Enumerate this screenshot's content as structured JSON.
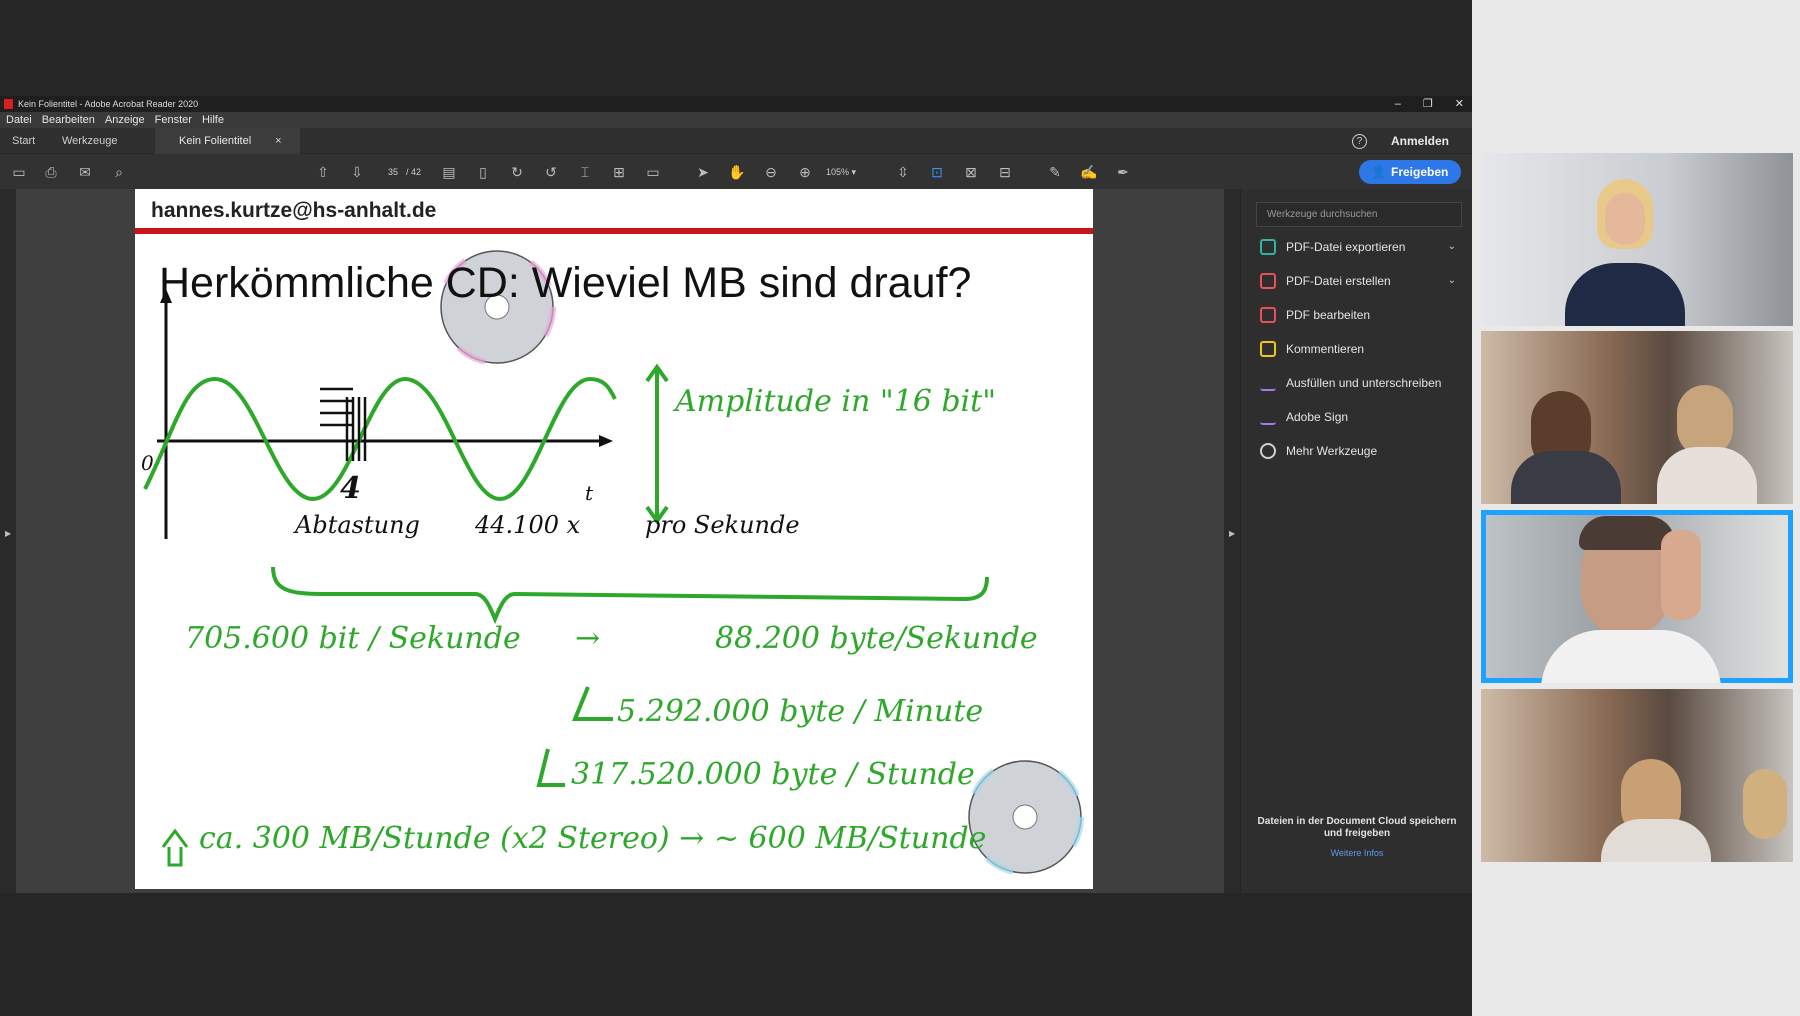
{
  "window": {
    "title": "Kein Folientitel - Adobe Acrobat Reader 2020",
    "controls": [
      "–",
      "❐",
      "✕"
    ]
  },
  "menu": [
    "Datei",
    "Bearbeiten",
    "Anzeige",
    "Fenster",
    "Hilfe"
  ],
  "tabs": {
    "start": "Start",
    "tools": "Werkzeuge",
    "document": "Kein Folientitel",
    "close": "×",
    "help": "?",
    "signin": "Anmelden"
  },
  "toolbar": {
    "page_current": "35",
    "page_total": "/ 42",
    "zoom": "105%",
    "zoom_arrow": "▾",
    "share": "Freigeben"
  },
  "slide": {
    "email": "hannes.kurtze@hs-anhalt.de",
    "heading": "Herkömmliche CD: Wieviel MB sind drauf?",
    "axis_zero": "0",
    "axis_t": "t",
    "arrow_label": "4",
    "amplitude": "Amplitude in \"16 bit\"",
    "sampling": "Abtastung",
    "rate": "44.100 x",
    "per_second": "pro Sekunde",
    "line1_left": "705.600 bit / Sekunde",
    "line1_right": "88.200 byte/Sekunde",
    "line2": "5.292.000 byte / Minute",
    "line3": "317.520.000 byte / Stunde",
    "line4": "ca. 300 MB/Stunde (x2 Stereo) → ~ 600 MB/Stunde",
    "colors": {
      "ink_green": "#2ea82b",
      "red_rule": "#c8151b"
    }
  },
  "tools_panel": {
    "search_placeholder": "Werkzeuge durchsuchen",
    "items": [
      {
        "label": "PDF-Datei exportieren",
        "icon": "export-pdf-icon",
        "color": "#2fb5a0",
        "chevron": "⌄"
      },
      {
        "label": "PDF-Datei erstellen",
        "icon": "create-pdf-icon",
        "color": "#e9505a",
        "chevron": "⌄"
      },
      {
        "label": "PDF bearbeiten",
        "icon": "edit-pdf-icon",
        "color": "#e9505a"
      },
      {
        "label": "Kommentieren",
        "icon": "comment-icon",
        "color": "#f0c419"
      },
      {
        "label": "Ausfüllen und unterschreiben",
        "icon": "fill-sign-icon",
        "color": "#a877e8"
      },
      {
        "label": "Adobe Sign",
        "icon": "adobe-sign-icon",
        "color": "#a877e8"
      },
      {
        "label": "Mehr Werkzeuge",
        "icon": "more-tools-icon",
        "color": "#cfcfcf"
      }
    ],
    "cloud_text": "Dateien in der Document Cloud speichern und freigeben",
    "more_info": "Weitere Infos"
  },
  "gallery": {
    "accent": "#1fa2ff",
    "tiles": [
      "participant-1",
      "participant-2",
      "participant-3-speaking",
      "participant-4"
    ]
  }
}
